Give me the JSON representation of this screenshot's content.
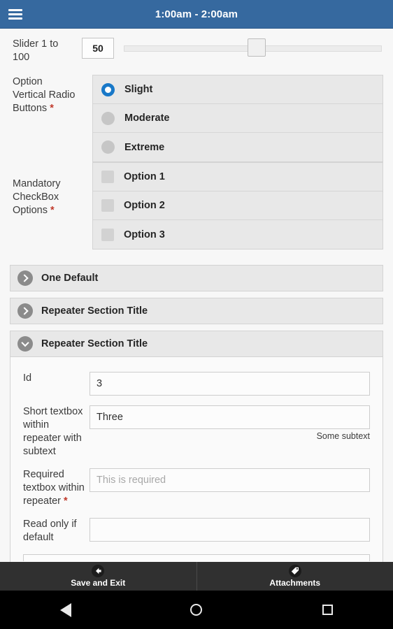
{
  "appbar": {
    "menu_icon": "hamburger-menu-icon",
    "title": "1:00am - 2:00am"
  },
  "form": {
    "slider": {
      "label": "Slider 1 to 100",
      "value": "50",
      "min": 1,
      "max": 100,
      "thumb_percent": 48
    },
    "radio_group": {
      "label": "Option Vertical Radio Buttons",
      "required_marker": "*",
      "selected": "Slight",
      "options": [
        {
          "label": "Slight",
          "selected": true
        },
        {
          "label": "Moderate",
          "selected": false
        },
        {
          "label": "Extreme",
          "selected": false
        }
      ]
    },
    "checkbox_group": {
      "label": "Mandatory CheckBox Options",
      "required_marker": "*",
      "options": [
        {
          "label": "Option 1",
          "checked": false
        },
        {
          "label": "Option 2",
          "checked": false
        },
        {
          "label": "Option 3",
          "checked": false
        }
      ]
    },
    "sections": [
      {
        "title": "One Default",
        "expanded": false,
        "icon": "chevron-right-icon"
      },
      {
        "title": "Repeater Section Title",
        "expanded": false,
        "icon": "chevron-right-icon"
      },
      {
        "title": "Repeater Section Title",
        "expanded": true,
        "icon": "chevron-down-icon"
      }
    ],
    "repeater_fields": {
      "id": {
        "label": "Id",
        "value": "3"
      },
      "short_textbox": {
        "label": "Short textbox within repeater with subtext",
        "value": "Three",
        "subtext": "Some subtext"
      },
      "required_textbox": {
        "label": "Required textbox within repeater",
        "required_marker": "*",
        "value": "",
        "placeholder": "This is required"
      },
      "readonly_field": {
        "label": "Read only if default",
        "value": ""
      }
    }
  },
  "bottom_bar": {
    "buttons": [
      {
        "label": "Save and Exit",
        "icon": "back-arrow-icon"
      },
      {
        "label": "Attachments",
        "icon": "tag-icon"
      }
    ]
  },
  "navbar": {
    "back": "back-triangle-icon",
    "home": "home-circle-icon",
    "recents": "recents-square-icon"
  },
  "colors": {
    "appbar": "#36699f",
    "accent_radio": "#1878c8",
    "required": "#c0392b",
    "bottom_bar": "#303030",
    "navbar": "#000000",
    "group_bg": "#e8e8e8"
  }
}
